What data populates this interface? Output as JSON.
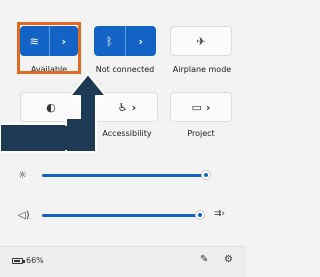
{
  "tiles": {
    "wifi": {
      "label": "Available",
      "icon": "wifi-icon",
      "glyph": "≋",
      "chevron": "›"
    },
    "bluetooth": {
      "label": "Not connected",
      "icon": "bluetooth-icon",
      "glyph": "ᛒ",
      "chevron": "›"
    },
    "airplane": {
      "label": "Airplane mode",
      "icon": "airplane-icon",
      "glyph": "✈"
    },
    "battery_saver": {
      "label": "",
      "icon": "battery-saver-icon",
      "glyph": "◐"
    },
    "accessibility": {
      "label": "Accessibility",
      "icon": "accessibility-icon",
      "glyph": "♿",
      "chevron": "›"
    },
    "project": {
      "label": "Project",
      "icon": "project-icon",
      "glyph": "▭",
      "chevron": "›"
    }
  },
  "sliders": {
    "brightness": {
      "icon": "brightness-icon",
      "glyph": "☼",
      "level": 1.0
    },
    "volume": {
      "icon": "volume-icon",
      "glyph": "◁)",
      "level": 1.0,
      "after_icon": "audio-output-icon",
      "after_glyph": "⇉›"
    }
  },
  "footer": {
    "battery_text": "66%",
    "battery_level": 0.66,
    "edit_icon": "pencil-icon",
    "settings_icon": "gear-icon"
  },
  "colors": {
    "accent": "#1263c5",
    "highlight": "#e06a24",
    "arrow": "#1d3a55"
  }
}
